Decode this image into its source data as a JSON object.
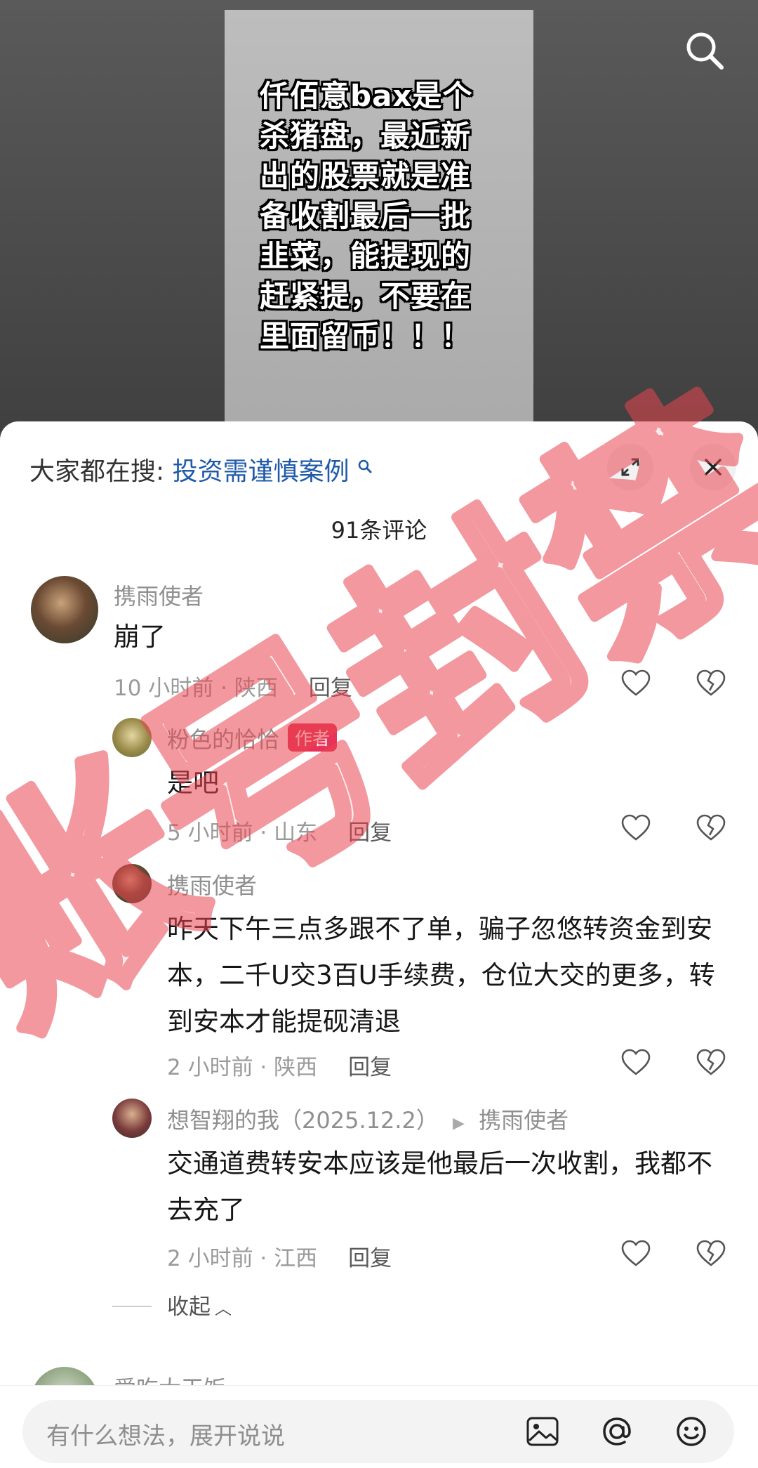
{
  "video": {
    "overlay_lines": [
      "仟佰意bax是个",
      "杀猪盘，最近新",
      "出的股票就是准",
      "备收割最后一批",
      "韭菜，能提现的",
      "赶紧提，不要在",
      "里面留币！！！"
    ]
  },
  "sheet": {
    "search_prefix": "大家都在搜:",
    "search_query": "投资需谨慎案例",
    "comment_count": "91条评论"
  },
  "comments": [
    {
      "user": "携雨使者",
      "text": "崩了",
      "time": "10 小时前 · 陕西",
      "reply": "回复"
    },
    {
      "user": "粉色的恰恰",
      "badge": "作者",
      "text": "是吧",
      "time": "5 小时前 · 山东",
      "reply": "回复"
    },
    {
      "user": "携雨使者",
      "text": "昨天下午三点多跟不了单，骗子忽悠转资金到安本，二千U交3百U手续费，仓位大交的更多，转到安本才能提砚清退",
      "time": "2 小时前 · 陕西",
      "reply": "回复"
    },
    {
      "user": "想智翔的我（2025.12.2）",
      "reply_to": "携雨使者",
      "text": "交通道费转安本应该是他最后一次收割，我都不去充了",
      "time": "2 小时前 · 江西",
      "reply": "回复"
    },
    {
      "user": "爱吃大干饭"
    }
  ],
  "collapse_label": "收起",
  "input": {
    "placeholder": "有什么想法，展开说说"
  },
  "watermark": {
    "text": "账号封禁",
    "color": "#e8454f"
  }
}
